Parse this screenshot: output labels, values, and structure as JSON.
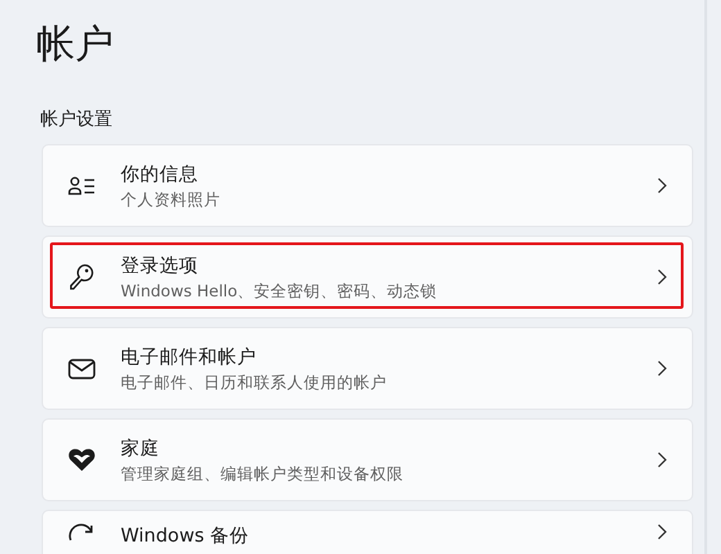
{
  "page_title": "帐户",
  "section_label": "帐户设置",
  "items": [
    {
      "kind": "profile",
      "title": "你的信息",
      "subtitle": "个人资料照片",
      "highlighted": false
    },
    {
      "kind": "key",
      "title": "登录选项",
      "subtitle": "Windows Hello、安全密钥、密码、动态锁",
      "highlighted": true
    },
    {
      "kind": "mail",
      "title": "电子邮件和帐户",
      "subtitle": "电子邮件、日历和联系人使用的帐户",
      "highlighted": false
    },
    {
      "kind": "family",
      "title": "家庭",
      "subtitle": "管理家庭组、编辑帐户类型和设备权限",
      "highlighted": false
    },
    {
      "kind": "backup",
      "title": "Windows 备份",
      "highlighted": false
    }
  ]
}
